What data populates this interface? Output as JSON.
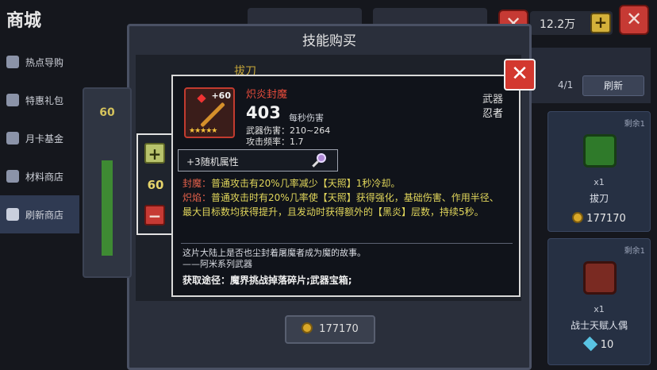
{
  "page": {
    "title": "商城"
  },
  "sidebar": {
    "items": [
      {
        "label": "热点导购"
      },
      {
        "label": "特惠礼包"
      },
      {
        "label": "月卡基金"
      },
      {
        "label": "材料商店"
      },
      {
        "label": "刷新商店"
      }
    ]
  },
  "top_bar": {
    "money": "12.2万"
  },
  "shop": {
    "refresh_count": "4/1",
    "refresh_label": "刷新",
    "cards": [
      {
        "remain": "剩余1",
        "qty": "x1",
        "name": "拔刀",
        "price": "177170",
        "currency": "coin"
      },
      {
        "remain": "剩余1",
        "qty": "x1",
        "name": "战士天赋人偶",
        "price": "10",
        "currency": "gem"
      }
    ]
  },
  "dialog": {
    "title": "技能购买",
    "item_name": "拔刀",
    "buy_price": "177170",
    "quantity": "60"
  },
  "detail": {
    "name": "炽炎封魔",
    "level": "+60",
    "stars": "★★★★★",
    "dps_value": "403",
    "dps_label": "每秒伤害",
    "weapon_damage": "武器伤害：210~264",
    "attack_rate": "攻击频率：1.7",
    "type": "武器",
    "class": "忍者",
    "random_attr": "+3随机属性",
    "effects": [
      {
        "tag": "封魔：",
        "text": "普通攻击有20%几率减少【天照】1秒冷却。"
      },
      {
        "tag": "炽焰：",
        "text": "普通攻击时有20%几率使【天照】获得强化，基础伤害、作用半径、最大目标数均获得提升，且发动时获得额外的【黑炎】层数，持续5秒。"
      }
    ],
    "lore_line1": "这片大陆上是否也尘封着屠魔者成为魔的故事。",
    "lore_line2": "——阿米系列武器",
    "source": "获取途径：魔界挑战掉落碎片;武器宝箱;"
  },
  "colors": {
    "accent_red": "#d3382f",
    "name_red": "#e64b3b",
    "effect_yellow": "#e1d65b",
    "coin_gold": "#d9a829"
  }
}
